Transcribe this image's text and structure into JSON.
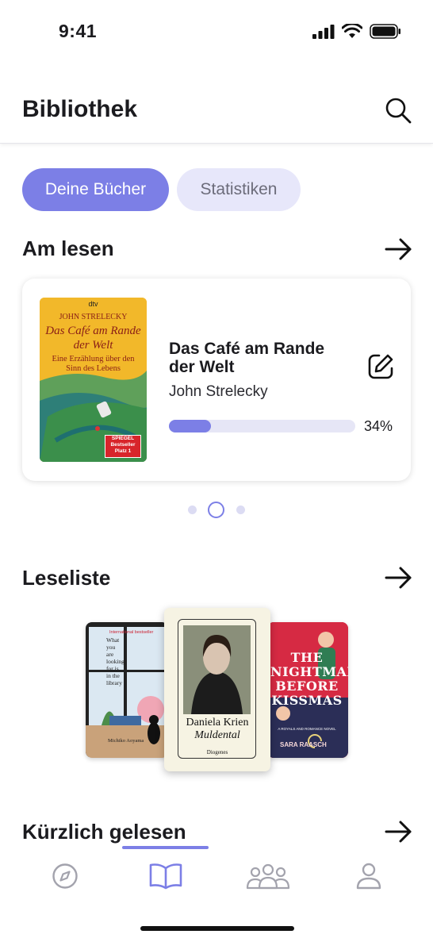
{
  "status_bar": {
    "time": "9:41"
  },
  "header": {
    "title": "Bibliothek"
  },
  "tabs": [
    {
      "label": "Deine Bücher",
      "active": true
    },
    {
      "label": "Statistiken",
      "active": false
    }
  ],
  "currently_reading": {
    "section_title": "Am lesen",
    "book": {
      "title": "Das Café am Rande der Welt",
      "author": "John Strelecky",
      "progress_percent": 34,
      "progress_label": "34%",
      "cover": {
        "publisher": "dtv",
        "author": "JOHN STRELECKY",
        "title": "Das Café am Rande der Welt",
        "subtitle": "Eine Erzählung über den Sinn des Lebens",
        "badge_top": "SPIEGEL",
        "badge_bottom": "Bestseller Platz 1"
      }
    },
    "pagination": {
      "total": 3,
      "active": 2
    }
  },
  "reading_list": {
    "section_title": "Leseliste",
    "covers": [
      {
        "id": "left",
        "top": "International bestseller",
        "title": "What you are looking for is in the library",
        "author": "Michiko Aoyama"
      },
      {
        "id": "center",
        "author": "Daniela Krien",
        "title": "Muldental",
        "publisher": "Diogenes"
      },
      {
        "id": "right",
        "title": "THE NIGHTMARE BEFORE KISSMAS",
        "tagline": "A ROYALS AND ROMANCE NOVEL",
        "author": "SARA RAASCH"
      }
    ]
  },
  "recently_read": {
    "section_title": "Kürzlich gelesen"
  },
  "bottom_nav": {
    "items": [
      {
        "icon": "compass-icon",
        "active": false
      },
      {
        "icon": "book-open-icon",
        "active": true
      },
      {
        "icon": "community-icon",
        "active": false
      },
      {
        "icon": "profile-icon",
        "active": false
      }
    ]
  },
  "colors": {
    "accent": "#7c7fe6",
    "accent_light": "#e7e7fa",
    "text": "#1b1b1f"
  }
}
